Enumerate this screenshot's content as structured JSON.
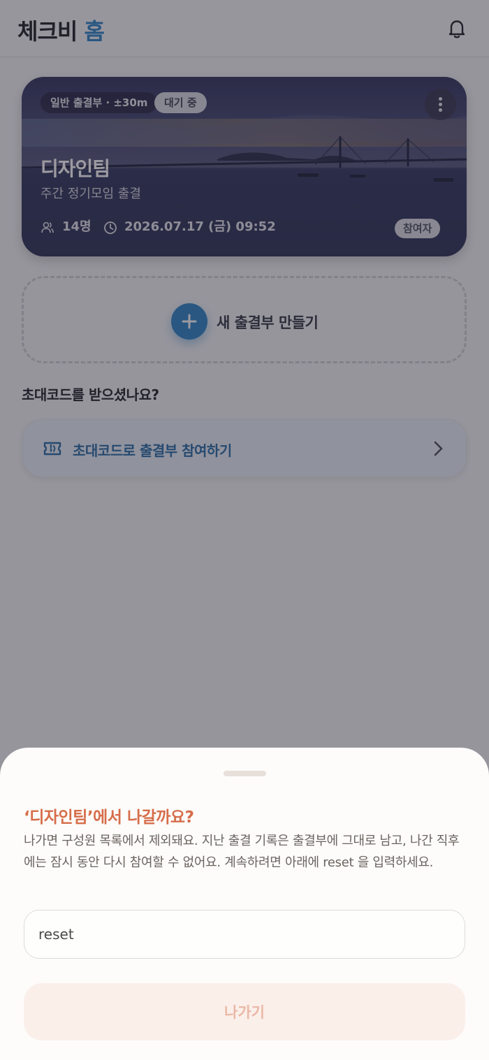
{
  "header": {
    "title_main": "체크비",
    "title_accent": "홈",
    "bell_icon": "bell-icon"
  },
  "card": {
    "type_chip": "일반 출결부 · ±30m",
    "status_chip": "대기 중",
    "name": "디자인팀",
    "subtitle": "주간 정기모임 출결",
    "members": "14명",
    "datetime": "2026.07.17 (금) 09:52",
    "role": "참여자",
    "more_icon": "more-vertical-icon"
  },
  "create": {
    "label": "새 출결부 만들기",
    "icon": "plus-icon"
  },
  "invite": {
    "question": "초대코드를 받으셨나요?",
    "label": "초대코드로 출결부 참여하기",
    "icon": "ticket-icon",
    "chevron": "chevron-right-icon"
  },
  "sheet": {
    "title": "‘디자인팀’에서 나갈까요?",
    "description": "나가면 구성원 목록에서 제외돼요. 지난 출결 기록은 출결부에 그대로 남고, 나간 직후에는 잠시 동안 다시 참여할 수 없어요. 계속하려면 아래에 reset 을 입력하세요.",
    "input_value": "reset",
    "leave_label": "나가기"
  },
  "colors": {
    "accent": "#2e86c8",
    "danger": "#d66d4a"
  }
}
